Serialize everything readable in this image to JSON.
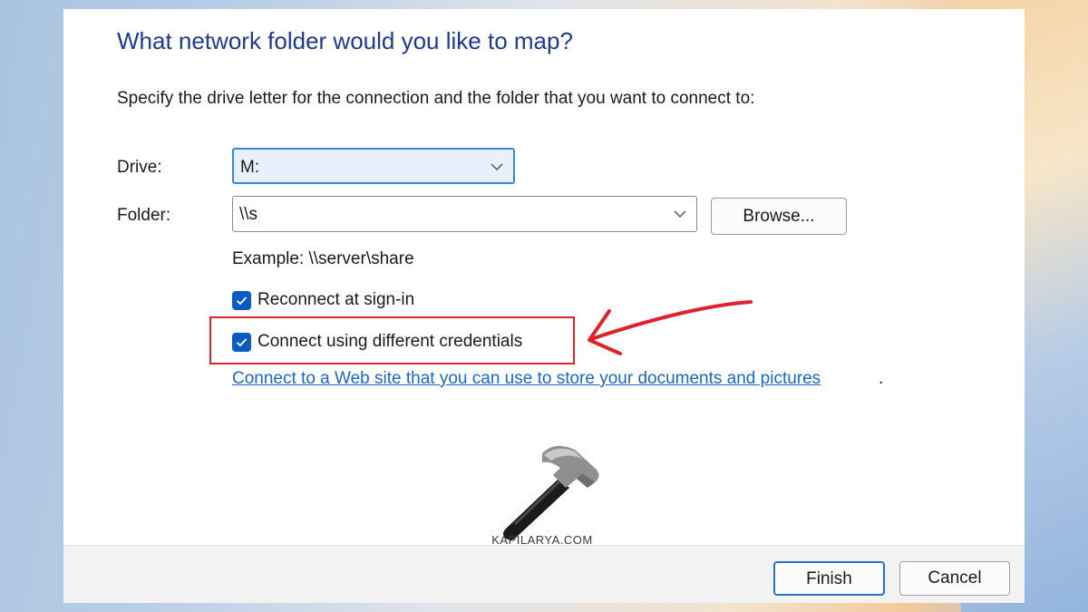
{
  "dialog": {
    "title": "What network folder would you like to map?",
    "instructions": "Specify the drive letter for the connection and the folder that you want to connect to:",
    "drive": {
      "label": "Drive:",
      "value": "M:"
    },
    "folder": {
      "label": "Folder:",
      "value": "\\\\s"
    },
    "browse_label": "Browse...",
    "example": "Example: \\\\server\\share",
    "reconnect": {
      "label": "Reconnect at sign-in",
      "checked": true
    },
    "credentials": {
      "label": "Connect using different credentials",
      "checked": true
    },
    "web_link": "Connect to a Web site that you can use to store your documents and pictures",
    "web_link_suffix": "."
  },
  "footer": {
    "finish_label": "Finish",
    "cancel_label": "Cancel"
  },
  "watermark": {
    "text": "KAPILARYA.COM"
  },
  "colors": {
    "title": "#1e3a96",
    "accent": "#0a5cc2",
    "link": "#1a67c8",
    "highlight": "#e0222a"
  }
}
